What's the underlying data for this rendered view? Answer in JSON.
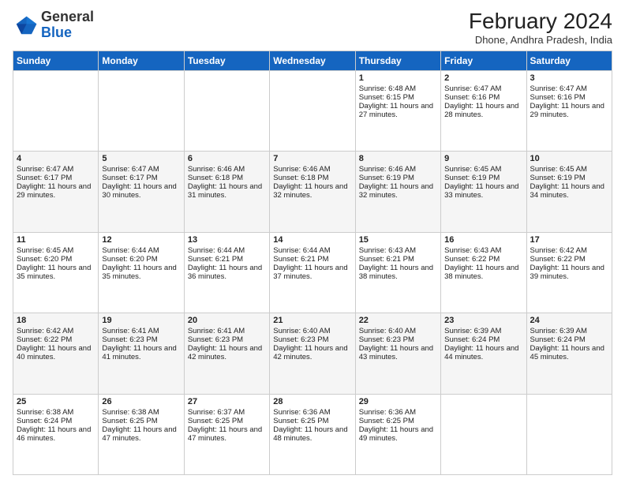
{
  "header": {
    "logo_general": "General",
    "logo_blue": "Blue",
    "month_year": "February 2024",
    "location": "Dhone, Andhra Pradesh, India"
  },
  "days_of_week": [
    "Sunday",
    "Monday",
    "Tuesday",
    "Wednesday",
    "Thursday",
    "Friday",
    "Saturday"
  ],
  "weeks": [
    [
      {
        "day": "",
        "sunrise": "",
        "sunset": "",
        "daylight": ""
      },
      {
        "day": "",
        "sunrise": "",
        "sunset": "",
        "daylight": ""
      },
      {
        "day": "",
        "sunrise": "",
        "sunset": "",
        "daylight": ""
      },
      {
        "day": "",
        "sunrise": "",
        "sunset": "",
        "daylight": ""
      },
      {
        "day": "1",
        "sunrise": "Sunrise: 6:48 AM",
        "sunset": "Sunset: 6:15 PM",
        "daylight": "Daylight: 11 hours and 27 minutes."
      },
      {
        "day": "2",
        "sunrise": "Sunrise: 6:47 AM",
        "sunset": "Sunset: 6:16 PM",
        "daylight": "Daylight: 11 hours and 28 minutes."
      },
      {
        "day": "3",
        "sunrise": "Sunrise: 6:47 AM",
        "sunset": "Sunset: 6:16 PM",
        "daylight": "Daylight: 11 hours and 29 minutes."
      }
    ],
    [
      {
        "day": "4",
        "sunrise": "Sunrise: 6:47 AM",
        "sunset": "Sunset: 6:17 PM",
        "daylight": "Daylight: 11 hours and 29 minutes."
      },
      {
        "day": "5",
        "sunrise": "Sunrise: 6:47 AM",
        "sunset": "Sunset: 6:17 PM",
        "daylight": "Daylight: 11 hours and 30 minutes."
      },
      {
        "day": "6",
        "sunrise": "Sunrise: 6:46 AM",
        "sunset": "Sunset: 6:18 PM",
        "daylight": "Daylight: 11 hours and 31 minutes."
      },
      {
        "day": "7",
        "sunrise": "Sunrise: 6:46 AM",
        "sunset": "Sunset: 6:18 PM",
        "daylight": "Daylight: 11 hours and 32 minutes."
      },
      {
        "day": "8",
        "sunrise": "Sunrise: 6:46 AM",
        "sunset": "Sunset: 6:19 PM",
        "daylight": "Daylight: 11 hours and 32 minutes."
      },
      {
        "day": "9",
        "sunrise": "Sunrise: 6:45 AM",
        "sunset": "Sunset: 6:19 PM",
        "daylight": "Daylight: 11 hours and 33 minutes."
      },
      {
        "day": "10",
        "sunrise": "Sunrise: 6:45 AM",
        "sunset": "Sunset: 6:19 PM",
        "daylight": "Daylight: 11 hours and 34 minutes."
      }
    ],
    [
      {
        "day": "11",
        "sunrise": "Sunrise: 6:45 AM",
        "sunset": "Sunset: 6:20 PM",
        "daylight": "Daylight: 11 hours and 35 minutes."
      },
      {
        "day": "12",
        "sunrise": "Sunrise: 6:44 AM",
        "sunset": "Sunset: 6:20 PM",
        "daylight": "Daylight: 11 hours and 35 minutes."
      },
      {
        "day": "13",
        "sunrise": "Sunrise: 6:44 AM",
        "sunset": "Sunset: 6:21 PM",
        "daylight": "Daylight: 11 hours and 36 minutes."
      },
      {
        "day": "14",
        "sunrise": "Sunrise: 6:44 AM",
        "sunset": "Sunset: 6:21 PM",
        "daylight": "Daylight: 11 hours and 37 minutes."
      },
      {
        "day": "15",
        "sunrise": "Sunrise: 6:43 AM",
        "sunset": "Sunset: 6:21 PM",
        "daylight": "Daylight: 11 hours and 38 minutes."
      },
      {
        "day": "16",
        "sunrise": "Sunrise: 6:43 AM",
        "sunset": "Sunset: 6:22 PM",
        "daylight": "Daylight: 11 hours and 38 minutes."
      },
      {
        "day": "17",
        "sunrise": "Sunrise: 6:42 AM",
        "sunset": "Sunset: 6:22 PM",
        "daylight": "Daylight: 11 hours and 39 minutes."
      }
    ],
    [
      {
        "day": "18",
        "sunrise": "Sunrise: 6:42 AM",
        "sunset": "Sunset: 6:22 PM",
        "daylight": "Daylight: 11 hours and 40 minutes."
      },
      {
        "day": "19",
        "sunrise": "Sunrise: 6:41 AM",
        "sunset": "Sunset: 6:23 PM",
        "daylight": "Daylight: 11 hours and 41 minutes."
      },
      {
        "day": "20",
        "sunrise": "Sunrise: 6:41 AM",
        "sunset": "Sunset: 6:23 PM",
        "daylight": "Daylight: 11 hours and 42 minutes."
      },
      {
        "day": "21",
        "sunrise": "Sunrise: 6:40 AM",
        "sunset": "Sunset: 6:23 PM",
        "daylight": "Daylight: 11 hours and 42 minutes."
      },
      {
        "day": "22",
        "sunrise": "Sunrise: 6:40 AM",
        "sunset": "Sunset: 6:23 PM",
        "daylight": "Daylight: 11 hours and 43 minutes."
      },
      {
        "day": "23",
        "sunrise": "Sunrise: 6:39 AM",
        "sunset": "Sunset: 6:24 PM",
        "daylight": "Daylight: 11 hours and 44 minutes."
      },
      {
        "day": "24",
        "sunrise": "Sunrise: 6:39 AM",
        "sunset": "Sunset: 6:24 PM",
        "daylight": "Daylight: 11 hours and 45 minutes."
      }
    ],
    [
      {
        "day": "25",
        "sunrise": "Sunrise: 6:38 AM",
        "sunset": "Sunset: 6:24 PM",
        "daylight": "Daylight: 11 hours and 46 minutes."
      },
      {
        "day": "26",
        "sunrise": "Sunrise: 6:38 AM",
        "sunset": "Sunset: 6:25 PM",
        "daylight": "Daylight: 11 hours and 47 minutes."
      },
      {
        "day": "27",
        "sunrise": "Sunrise: 6:37 AM",
        "sunset": "Sunset: 6:25 PM",
        "daylight": "Daylight: 11 hours and 47 minutes."
      },
      {
        "day": "28",
        "sunrise": "Sunrise: 6:36 AM",
        "sunset": "Sunset: 6:25 PM",
        "daylight": "Daylight: 11 hours and 48 minutes."
      },
      {
        "day": "29",
        "sunrise": "Sunrise: 6:36 AM",
        "sunset": "Sunset: 6:25 PM",
        "daylight": "Daylight: 11 hours and 49 minutes."
      },
      {
        "day": "",
        "sunrise": "",
        "sunset": "",
        "daylight": ""
      },
      {
        "day": "",
        "sunrise": "",
        "sunset": "",
        "daylight": ""
      }
    ]
  ]
}
